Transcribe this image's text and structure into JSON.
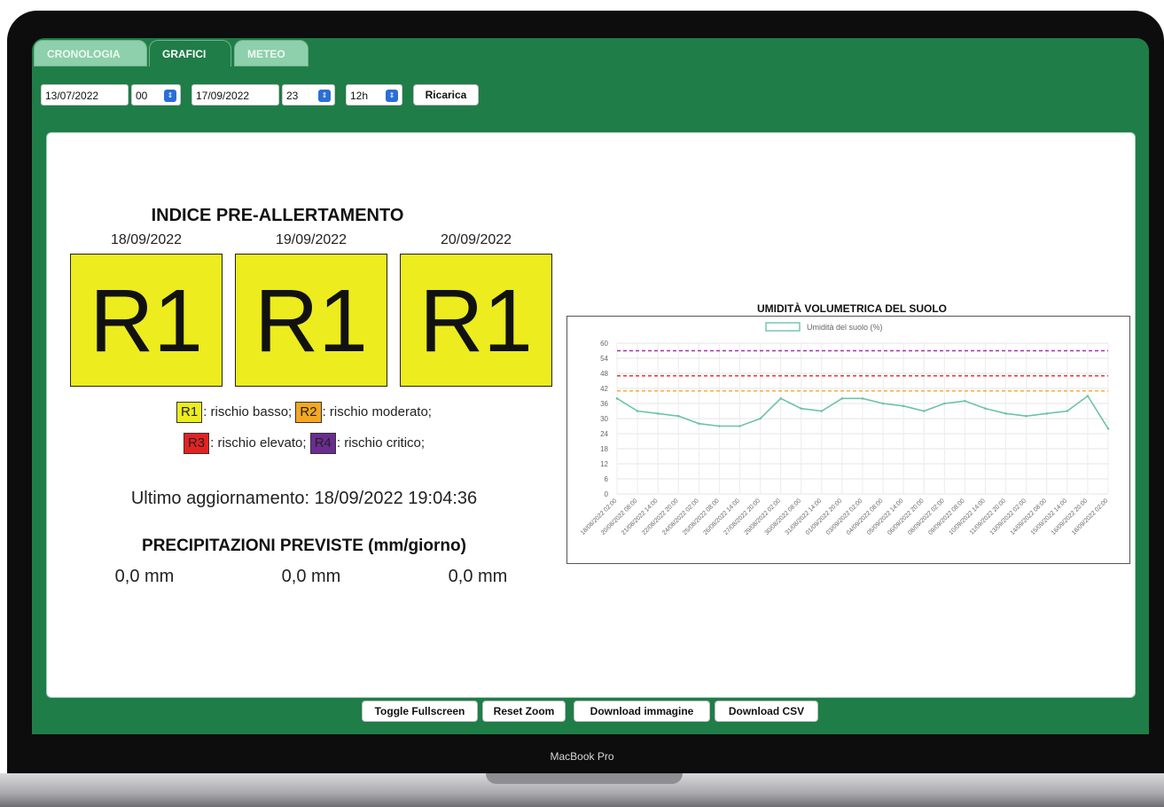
{
  "tabs": [
    {
      "label": "CRONOLOGIA",
      "active": false
    },
    {
      "label": "GRAFICI",
      "active": true
    },
    {
      "label": "METEO",
      "active": false
    }
  ],
  "controls": {
    "date_from": "13/07/2022",
    "hour_from": "00",
    "date_to": "17/09/2022",
    "hour_to": "23",
    "interval": "12h",
    "reload_label": "Ricarica"
  },
  "alert": {
    "title": "INDICE PRE-ALLERTAMENTO",
    "days": [
      {
        "date": "18/09/2022",
        "level": "R1"
      },
      {
        "date": "19/09/2022",
        "level": "R1"
      },
      {
        "date": "20/09/2022",
        "level": "R1"
      }
    ],
    "level_color": "#ecec1e",
    "legend": [
      {
        "code": "R1",
        "text": ": rischio basso;",
        "color": "#ecec1e"
      },
      {
        "code": "R2",
        "text": ": rischio moderato;",
        "color": "#f5a623"
      },
      {
        "code": "R3",
        "text": ": rischio elevato;",
        "color": "#e52222"
      },
      {
        "code": "R4",
        "text": ": rischio critico;",
        "color": "#6b2c91"
      }
    ],
    "last_update": "Ultimo aggiornamento: 18/09/2022 19:04:36"
  },
  "precipitation": {
    "title": "PRECIPITAZIONI PREVISTE (mm/giorno)",
    "values": [
      "0,0 mm",
      "0,0 mm",
      "0,0 mm"
    ]
  },
  "chart_data": {
    "type": "line",
    "title": "UMIDITÀ VOLUMETRICA DEL SUOLO",
    "legend_position": "top",
    "grid": true,
    "ylim": [
      0,
      60
    ],
    "yticks": [
      "0",
      "6",
      "12",
      "18",
      "24",
      "30",
      "36",
      "42",
      "48",
      "54",
      "60"
    ],
    "x": [
      "18/08/2022 02:00",
      "20/08/2022 08:00",
      "21/08/2022 14:00",
      "22/08/2022 20:00",
      "24/08/2022 02:00",
      "25/08/2022 08:00",
      "26/08/2022 14:00",
      "27/08/2022 20:00",
      "29/08/2022 02:00",
      "30/08/2022 08:00",
      "31/08/2022 14:00",
      "01/09/2022 20:00",
      "03/09/2022 02:00",
      "04/09/2022 08:00",
      "05/09/2022 14:00",
      "06/09/2022 20:00",
      "08/09/2022 02:00",
      "09/09/2022 08:00",
      "10/09/2022 14:00",
      "11/09/2022 20:00",
      "13/09/2022 02:00",
      "14/09/2022 08:00",
      "15/09/2022 14:00",
      "16/09/2022 20:00",
      "18/09/2022 02:00"
    ],
    "series": [
      {
        "name": "Umidità del suolo (%)",
        "color": "#6cc4a4",
        "values": [
          38,
          33,
          32,
          31,
          28,
          27,
          27,
          30,
          38,
          34,
          33,
          38,
          38,
          36,
          35,
          33,
          36,
          37,
          34,
          32,
          31,
          32,
          33,
          39,
          26
        ]
      }
    ],
    "thresholds": [
      {
        "value": 41,
        "color": "#f5a623"
      },
      {
        "value": 47,
        "color": "#e52222"
      },
      {
        "value": 57,
        "color": "#a72fb5"
      }
    ]
  },
  "footer_buttons": [
    "Toggle Fullscreen",
    "Reset Zoom",
    "Download immagine",
    "Download CSV"
  ],
  "device_label": "MacBook Pro"
}
